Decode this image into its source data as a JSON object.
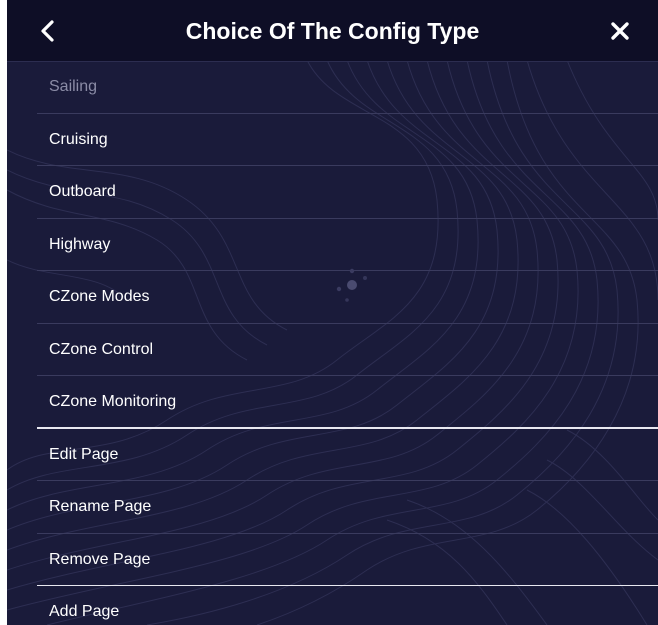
{
  "header": {
    "title": "Choice Of The Config Type",
    "back_icon": "chevron-left-icon",
    "close_icon": "close-icon"
  },
  "menu": {
    "items": [
      {
        "label": "Sailing",
        "disabled": true
      },
      {
        "label": "Cruising"
      },
      {
        "label": "Outboard"
      },
      {
        "label": "Highway"
      },
      {
        "label": "CZone Modes"
      },
      {
        "label": "CZone Control"
      },
      {
        "label": "CZone Monitoring"
      },
      {
        "label": "Edit Page"
      },
      {
        "label": "Rename Page"
      },
      {
        "label": "Remove Page"
      },
      {
        "label": "Add Page"
      }
    ]
  },
  "colors": {
    "background": "#1a1b3a",
    "header": "#0e0e26",
    "text": "#ffffff",
    "disabled_text": "#8b8ca6"
  }
}
